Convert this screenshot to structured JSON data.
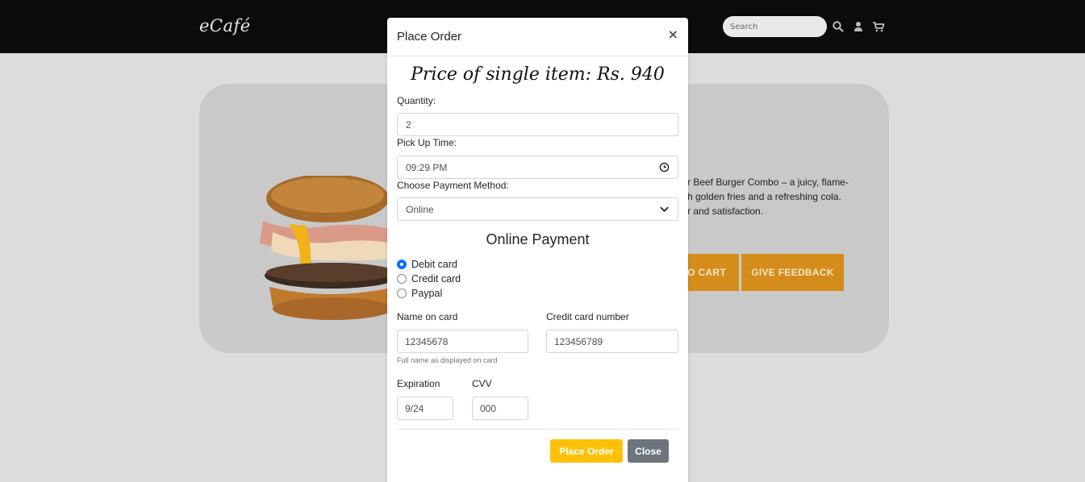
{
  "navbar": {
    "brand": "eCafé",
    "search_placeholder": "Search",
    "icons": [
      "search-icon",
      "user-icon",
      "cart-icon"
    ]
  },
  "product": {
    "description_lines": [
      "r Beef Burger Combo – a juicy, flame-",
      "h golden fries and a refreshing cola.",
      "r and satisfaction."
    ],
    "add_to_cart_label": "O CART",
    "feedback_label": "GIVE FEEDBACK"
  },
  "modal": {
    "title": "Place Order",
    "close_symbol": "×",
    "price_text": "Price of single item: Rs. 940",
    "quantity_label": "Quantity:",
    "quantity_value": "2",
    "pickup_label": "Pick Up Time:",
    "pickup_value": "09:29 PM",
    "payment_method_label": "Choose Payment Method:",
    "payment_method_value": "Online",
    "online_payment_title": "Online Payment",
    "payment_options": [
      {
        "label": "Debit card",
        "checked": true
      },
      {
        "label": "Credit card",
        "checked": false
      },
      {
        "label": "Paypal",
        "checked": false
      }
    ],
    "name_on_card_label": "Name on card",
    "name_on_card_value": "12345678",
    "name_hint": "Full name as displayed on card",
    "card_number_label": "Credit card number",
    "card_number_value": "123456789",
    "expiration_label": "Expiration",
    "expiration_value": "9/24",
    "cvv_label": "CVV",
    "cvv_value": "000",
    "place_order_label": "Place Order",
    "close_label": "Close"
  },
  "colors": {
    "navbar": "#0b0b0b",
    "accent_orange": "#d48c1a",
    "primary_yellow": "#ffc107",
    "secondary_gray": "#6c757d",
    "radio_blue": "#0d6efd"
  }
}
